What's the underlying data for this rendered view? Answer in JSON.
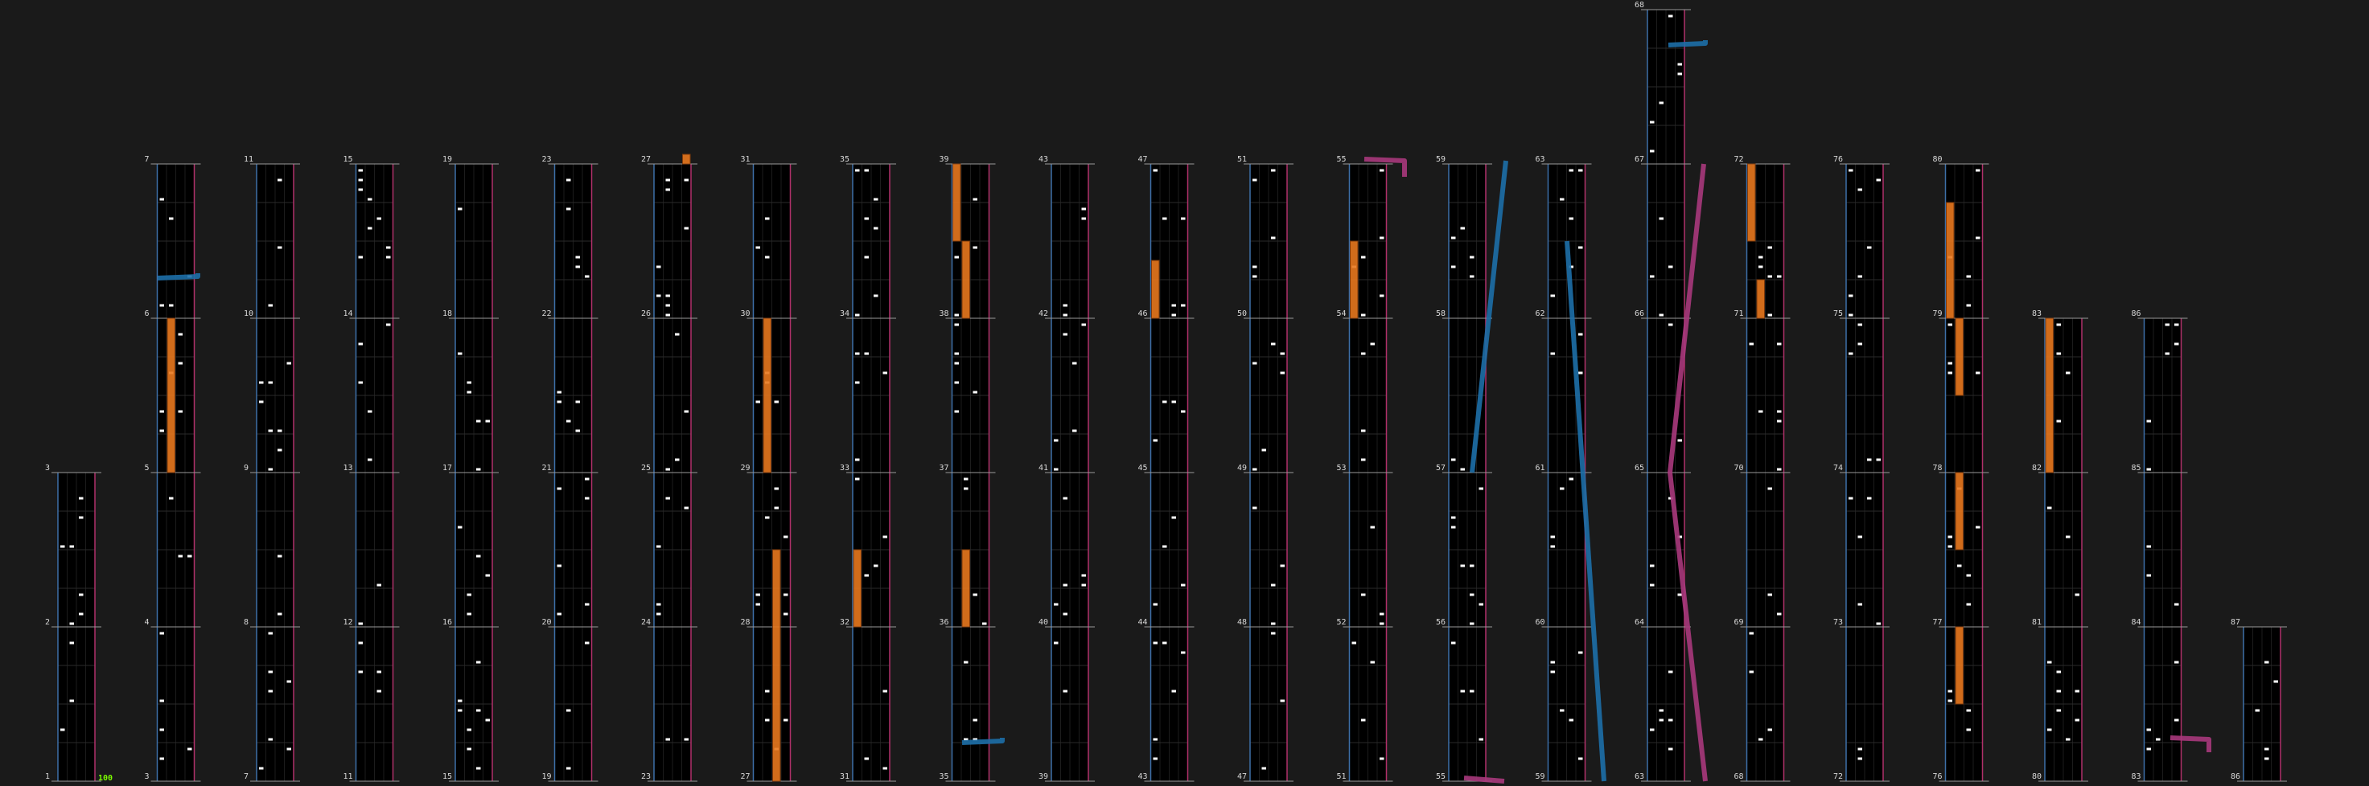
{
  "chart_data": {
    "type": "rhythm-game-chart-overview",
    "combo_label": "100",
    "colors": {
      "background": "#1a1a1a",
      "lane_bg": "#000000",
      "left_border": "#3d6fa8",
      "right_border": "#b0306a",
      "tap_note": "#ffffff",
      "hold_note": "#e8781e",
      "laser_left": "#1d6fa8",
      "laser_right": "#a8387c",
      "combo_text": "#7CFC00"
    },
    "columns": [
      {
        "measures": [
          1,
          2,
          3
        ]
      },
      {
        "measures": [
          3,
          4,
          5,
          6,
          7
        ]
      },
      {
        "measures": [
          7,
          8,
          9,
          10,
          11
        ]
      },
      {
        "measures": [
          11,
          12,
          13,
          14,
          15
        ]
      },
      {
        "measures": [
          15,
          16,
          17,
          18,
          19
        ]
      },
      {
        "measures": [
          19,
          20,
          21,
          22,
          23
        ]
      },
      {
        "measures": [
          23,
          24,
          25,
          26,
          27
        ]
      },
      {
        "measures": [
          27,
          28,
          29,
          30,
          31
        ]
      },
      {
        "measures": [
          31,
          32,
          33,
          34,
          35
        ]
      },
      {
        "measures": [
          35,
          36,
          37,
          38,
          39
        ]
      },
      {
        "measures": [
          39,
          40,
          41,
          42,
          43
        ]
      },
      {
        "measures": [
          43,
          44,
          45,
          46,
          47
        ]
      },
      {
        "measures": [
          47,
          48,
          49,
          50,
          51
        ]
      },
      {
        "measures": [
          51,
          52,
          53,
          54,
          55
        ]
      },
      {
        "measures": [
          55,
          56,
          57,
          58,
          59
        ]
      },
      {
        "measures": [
          59,
          60,
          61,
          62,
          63
        ]
      },
      {
        "measures": [
          63,
          64,
          65,
          66,
          67,
          68
        ]
      },
      {
        "measures": [
          68,
          69,
          70,
          71,
          72
        ]
      },
      {
        "measures": [
          72,
          73,
          74,
          75,
          76
        ]
      },
      {
        "measures": [
          76,
          77,
          78,
          79,
          80
        ]
      },
      {
        "measures": [
          80,
          81,
          82,
          83
        ]
      },
      {
        "measures": [
          83,
          84,
          85,
          86
        ]
      },
      {
        "measures": [
          86,
          87
        ]
      }
    ]
  }
}
